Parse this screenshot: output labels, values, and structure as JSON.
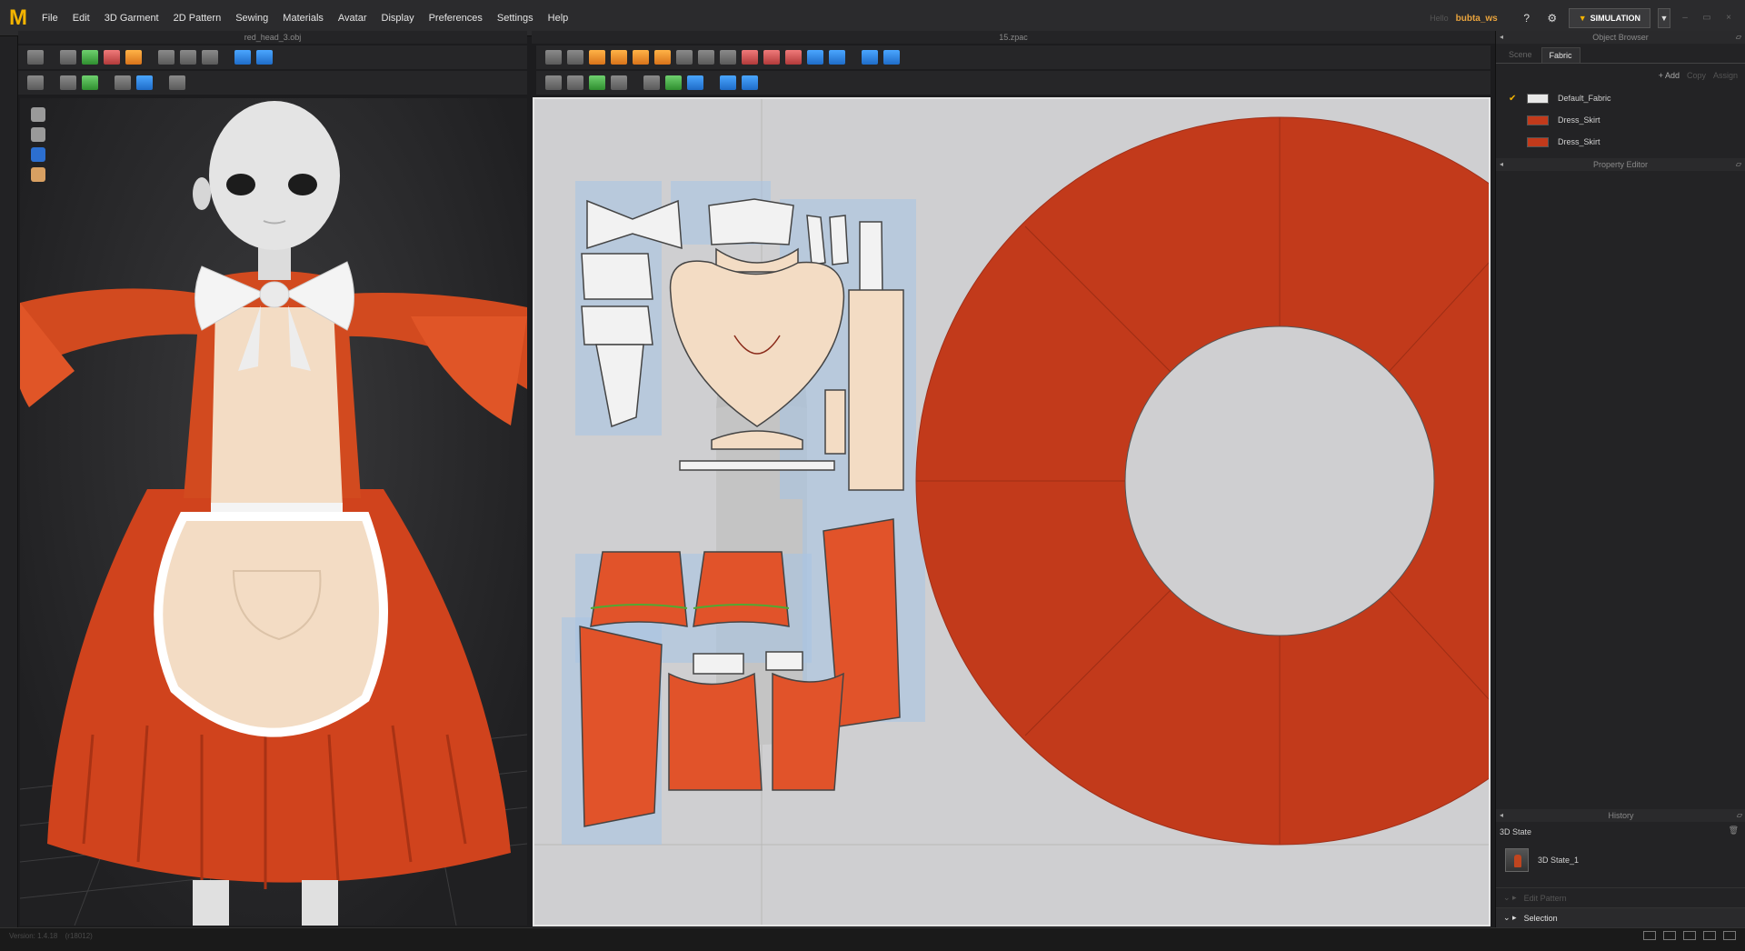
{
  "menu": {
    "logo": "M",
    "items": [
      "File",
      "Edit",
      "3D Garment",
      "2D Pattern",
      "Sewing",
      "Materials",
      "Avatar",
      "Display",
      "Preferences",
      "Settings",
      "Help"
    ]
  },
  "user": {
    "hello": "Hello",
    "name": "bubta_ws"
  },
  "simulation_label": "SIMULATION",
  "view3d": {
    "title": "red_head_3.obj"
  },
  "view2d": {
    "title": "15.zpac"
  },
  "object_browser": {
    "title": "Object Browser",
    "tabs": [
      "Scene",
      "Fabric"
    ],
    "active_tab": "Fabric",
    "actions": {
      "add": "+ Add",
      "copy": "Copy",
      "assign": "Assign"
    },
    "fabrics": [
      {
        "name": "Default_Fabric",
        "color": "#e8e8e8",
        "checked": true
      },
      {
        "name": "Dress_Skirt",
        "color": "#c23a1b",
        "checked": false
      },
      {
        "name": "Dress_Skirt",
        "color": "#c23a1b",
        "checked": false
      }
    ]
  },
  "property_editor": {
    "title": "Property Editor"
  },
  "history": {
    "title": "History",
    "state_label": "3D State",
    "entry": "3D State_1",
    "edit_pattern": "Edit Pattern",
    "selection": "Selection"
  },
  "status": {
    "version": "Version: 1.4.18",
    "build": "(r18012)"
  },
  "colors": {
    "accent": "#f4b400",
    "dress_red": "#c23a1b",
    "apron": "#f3dcc4",
    "pattern_bg": "#cfcfd1",
    "panel_bg": "#232325"
  },
  "icons": [
    "move-icon",
    "select-icon",
    "garment-icon",
    "avatar-icon",
    "help-icon",
    "settings-icon"
  ]
}
